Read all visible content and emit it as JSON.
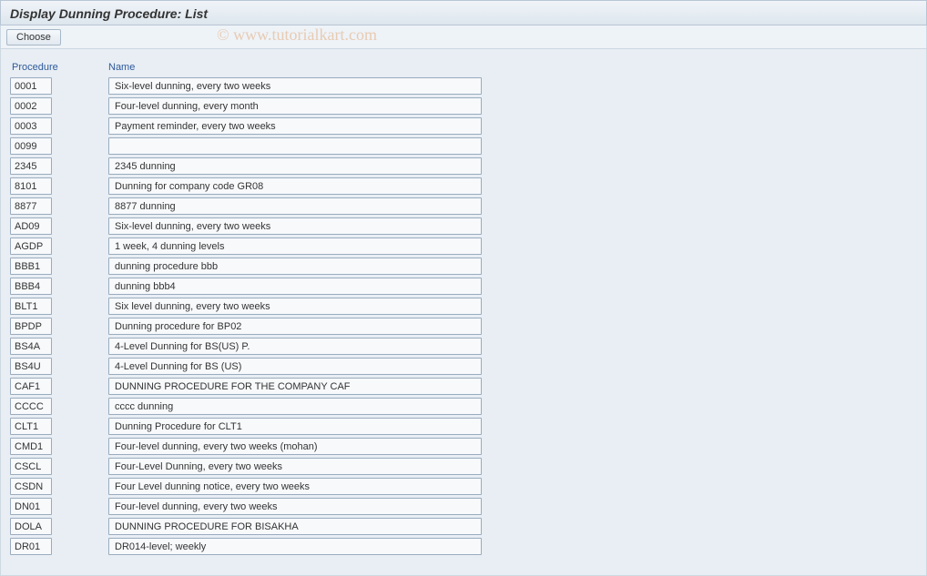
{
  "title": "Display Dunning Procedure: List",
  "toolbar": {
    "choose_label": "Choose"
  },
  "headers": {
    "procedure": "Procedure",
    "name": "Name"
  },
  "watermark": "© www.tutorialkart.com",
  "rows": [
    {
      "proc": "0001",
      "name": "Six-level dunning, every two weeks"
    },
    {
      "proc": "0002",
      "name": "Four-level dunning, every month"
    },
    {
      "proc": "0003",
      "name": "Payment reminder, every two weeks"
    },
    {
      "proc": "0099",
      "name": ""
    },
    {
      "proc": "2345",
      "name": " 2345 dunning"
    },
    {
      "proc": "8101",
      "name": "Dunning for company code GR08"
    },
    {
      "proc": "8877",
      "name": "8877 dunning"
    },
    {
      "proc": "AD09",
      "name": "Six-level dunning, every two weeks"
    },
    {
      "proc": "AGDP",
      "name": "1 week, 4 dunning levels"
    },
    {
      "proc": "BBB1",
      "name": "dunning procedure bbb"
    },
    {
      "proc": "BBB4",
      "name": "dunning bbb4"
    },
    {
      "proc": "BLT1",
      "name": "Six level dunning, every two weeks"
    },
    {
      "proc": "BPDP",
      "name": "Dunning procedure for BP02"
    },
    {
      "proc": "BS4A",
      "name": "4-Level Dunning for BS(US) P."
    },
    {
      "proc": "BS4U",
      "name": "4-Level Dunning for BS (US)"
    },
    {
      "proc": "CAF1",
      "name": "DUNNING PROCEDURE FOR THE COMPANY CAF"
    },
    {
      "proc": "CCCC",
      "name": "cccc dunning"
    },
    {
      "proc": "CLT1",
      "name": "Dunning Procedure for CLT1"
    },
    {
      "proc": "CMD1",
      "name": "Four-level dunning, every two weeks (mohan)"
    },
    {
      "proc": "CSCL",
      "name": "Four-Level Dunning, every two weeks"
    },
    {
      "proc": "CSDN",
      "name": "Four Level dunning notice, every two weeks"
    },
    {
      "proc": "DN01",
      "name": "Four-level dunning, every two weeks"
    },
    {
      "proc": "DOLA",
      "name": "DUNNING PROCEDURE FOR BISAKHA"
    },
    {
      "proc": "DR01",
      "name": "DR014-level; weekly"
    }
  ]
}
